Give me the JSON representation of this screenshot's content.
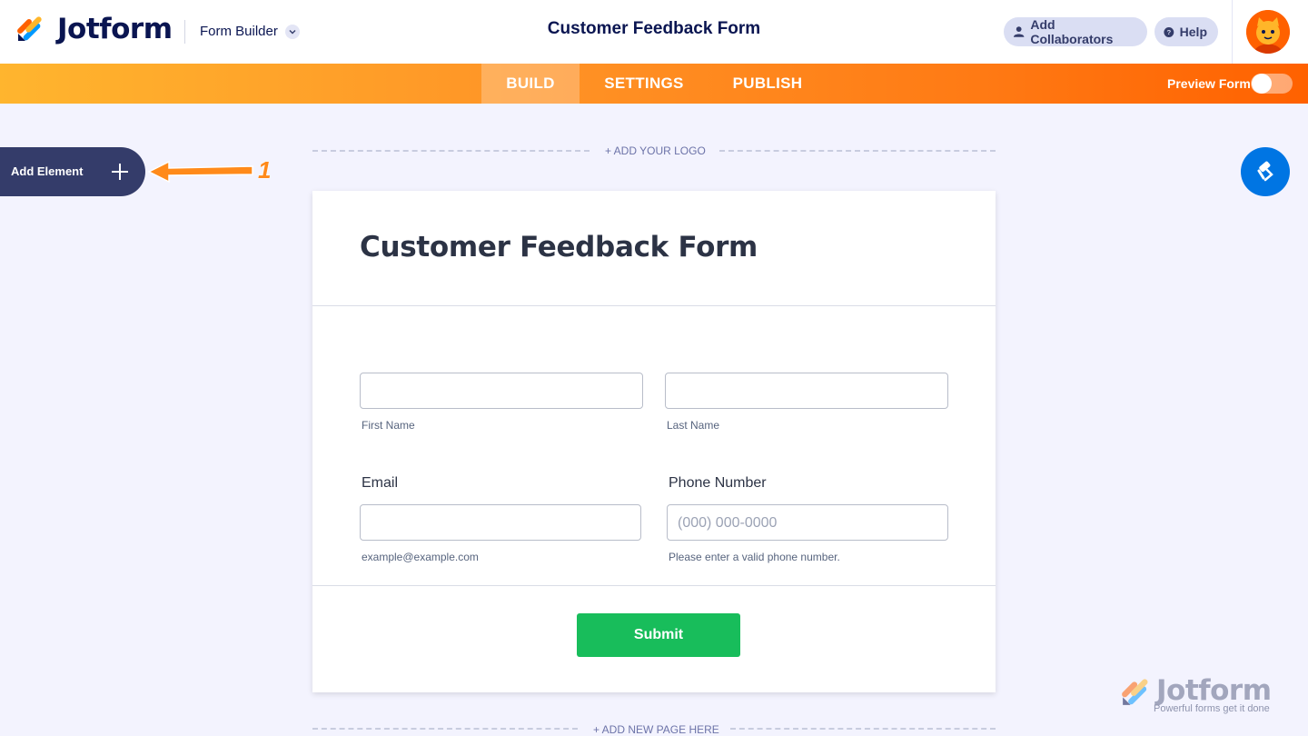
{
  "header": {
    "brand": "Jotform",
    "mode_label": "Form Builder",
    "title": "Customer Feedback Form",
    "collaborators_label": "Add Collaborators",
    "help_label": "Help"
  },
  "nav": {
    "tabs": [
      {
        "label": "BUILD",
        "active": true
      },
      {
        "label": "SETTINGS",
        "active": false
      },
      {
        "label": "PUBLISH",
        "active": false
      }
    ],
    "preview_label": "Preview Form",
    "preview_enabled": false
  },
  "sidebar": {
    "add_element_label": "Add Element",
    "annotation_number": "1"
  },
  "canvas": {
    "add_logo_label": "+ ADD YOUR LOGO",
    "add_page_label": "+ ADD NEW PAGE HERE"
  },
  "form": {
    "heading": "Customer Feedback Form",
    "fields": {
      "first_name": {
        "value": "",
        "sublabel": "First Name"
      },
      "last_name": {
        "value": "",
        "sublabel": "Last Name"
      },
      "email": {
        "label": "Email",
        "value": "",
        "sublabel": "example@example.com"
      },
      "phone": {
        "label": "Phone Number",
        "placeholder": "(000) 000-0000",
        "sublabel": "Please enter a valid phone number."
      }
    },
    "submit_label": "Submit"
  },
  "watermark": {
    "brand": "Jotform",
    "tagline": "Powerful forms get it done"
  },
  "colors": {
    "accent_orange": "#ff6100",
    "nav_gradient_start": "#ffb52e",
    "submit_green": "#18bd5b",
    "design_blue": "#0075e3",
    "dark_navy": "#343c6a",
    "canvas_bg": "#f3f3fe"
  },
  "icons": [
    "jotform-logo-icon",
    "chevron-down-icon",
    "user-icon",
    "help-icon",
    "avatar-icon",
    "plus-icon",
    "arrow-left-icon",
    "paint-roller-icon"
  ]
}
